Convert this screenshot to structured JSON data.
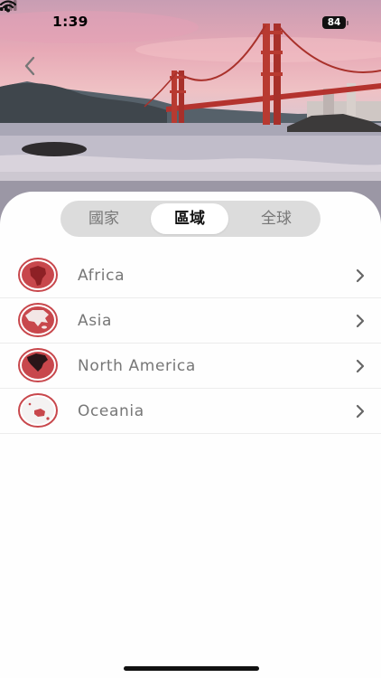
{
  "status_bar": {
    "time": "1:39",
    "battery": "84"
  },
  "navigation": {
    "back_icon": "chevron-left-icon"
  },
  "tabs": [
    {
      "label": "國家",
      "selected": false
    },
    {
      "label": "區域",
      "selected": true
    },
    {
      "label": "全球",
      "selected": false
    }
  ],
  "regions": [
    {
      "name": "Africa",
      "icon": "africa-globe-icon"
    },
    {
      "name": "Asia",
      "icon": "asia-globe-icon"
    },
    {
      "name": "North America",
      "icon": "north-america-globe-icon"
    },
    {
      "name": "Oceania",
      "icon": "oceania-globe-icon"
    }
  ],
  "colors": {
    "accent": "#c0444a",
    "tab_track": "#dcdcdc",
    "label": "#777777"
  }
}
